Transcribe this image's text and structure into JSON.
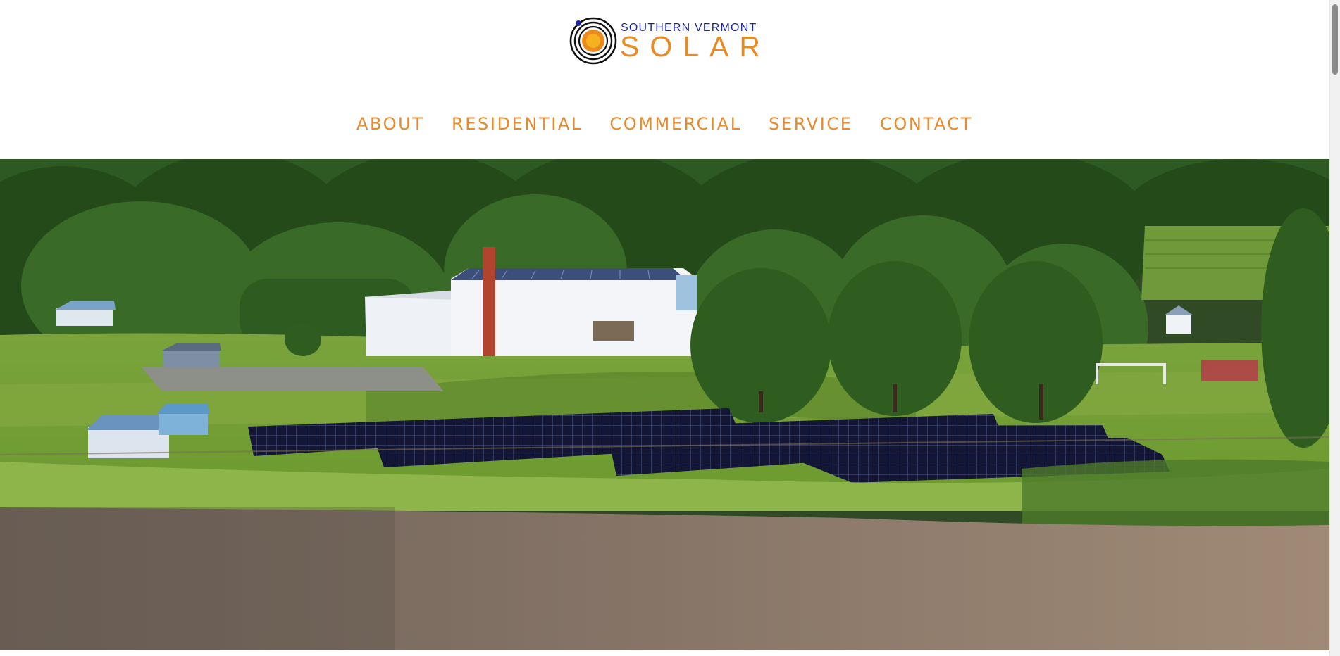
{
  "logo": {
    "top_text": "SOUTHERN VERMONT",
    "main_text": "SOLAR",
    "colors": {
      "blue": "#1b27a8",
      "orange": "#ec8a22",
      "ring": "#111111"
    }
  },
  "nav": {
    "items": [
      {
        "label": "ABOUT"
      },
      {
        "label": "RESIDENTIAL"
      },
      {
        "label": "COMMERCIAL"
      },
      {
        "label": "SERVICE"
      },
      {
        "label": "CONTACT"
      }
    ],
    "color": "#e88a2c"
  },
  "hero": {
    "scene": "aerial-photo-solar-array-field-school-forest"
  },
  "scrollbar": {
    "visible": true
  }
}
